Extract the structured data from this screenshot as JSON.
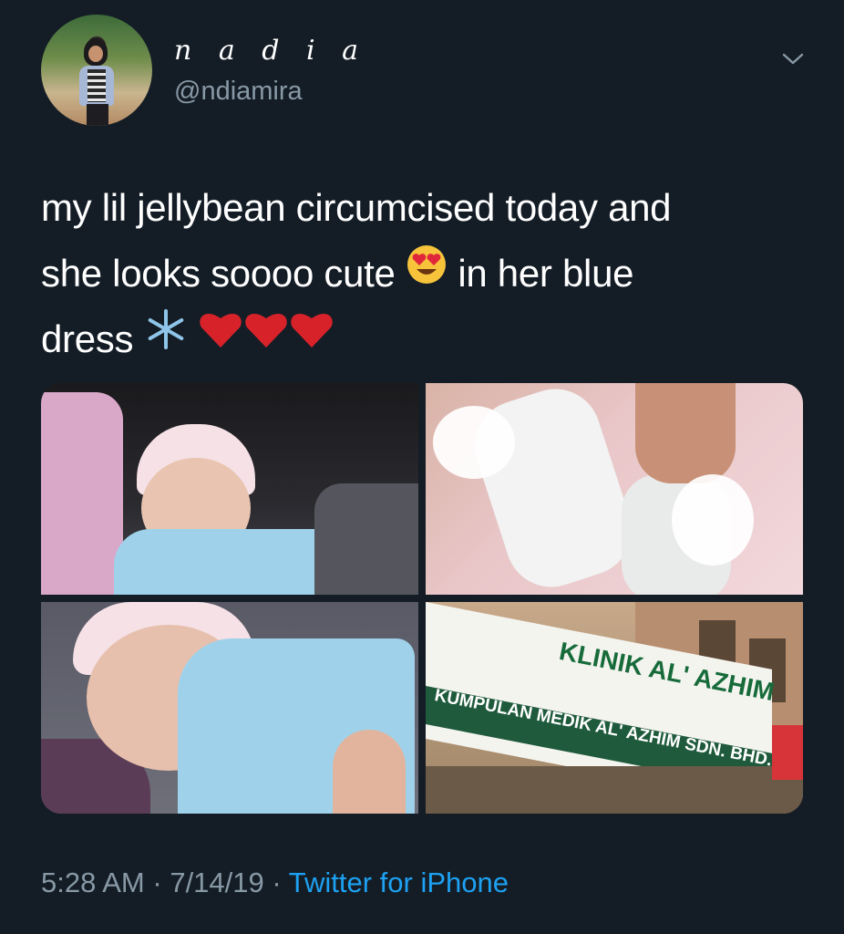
{
  "tweet": {
    "display_name": "n a d i a",
    "handle": "@ndiamira",
    "text_line1": "my lil jellybean circumcised today and",
    "text_line2a": "she looks soooo cute",
    "text_line2b": "in her blue",
    "text_line3": "dress",
    "emoji_heart_eyes": "😍",
    "emoji_snowflake": "❄️",
    "emoji_hearts": "❤️❤️❤️",
    "time": "5:28 AM",
    "date": "7/14/19",
    "sep": "·",
    "source": "Twitter for iPhone"
  },
  "media": {
    "sign_main": "KLINIK AL' AZHIM",
    "sign_sub": "KUMPULAN MEDIK AL' AZHIM SDN. BHD."
  },
  "colors": {
    "background": "#141d26",
    "secondary_text": "#8899a6",
    "link": "#1da1f2"
  },
  "icons": {
    "menu": "chevron-down-icon"
  }
}
